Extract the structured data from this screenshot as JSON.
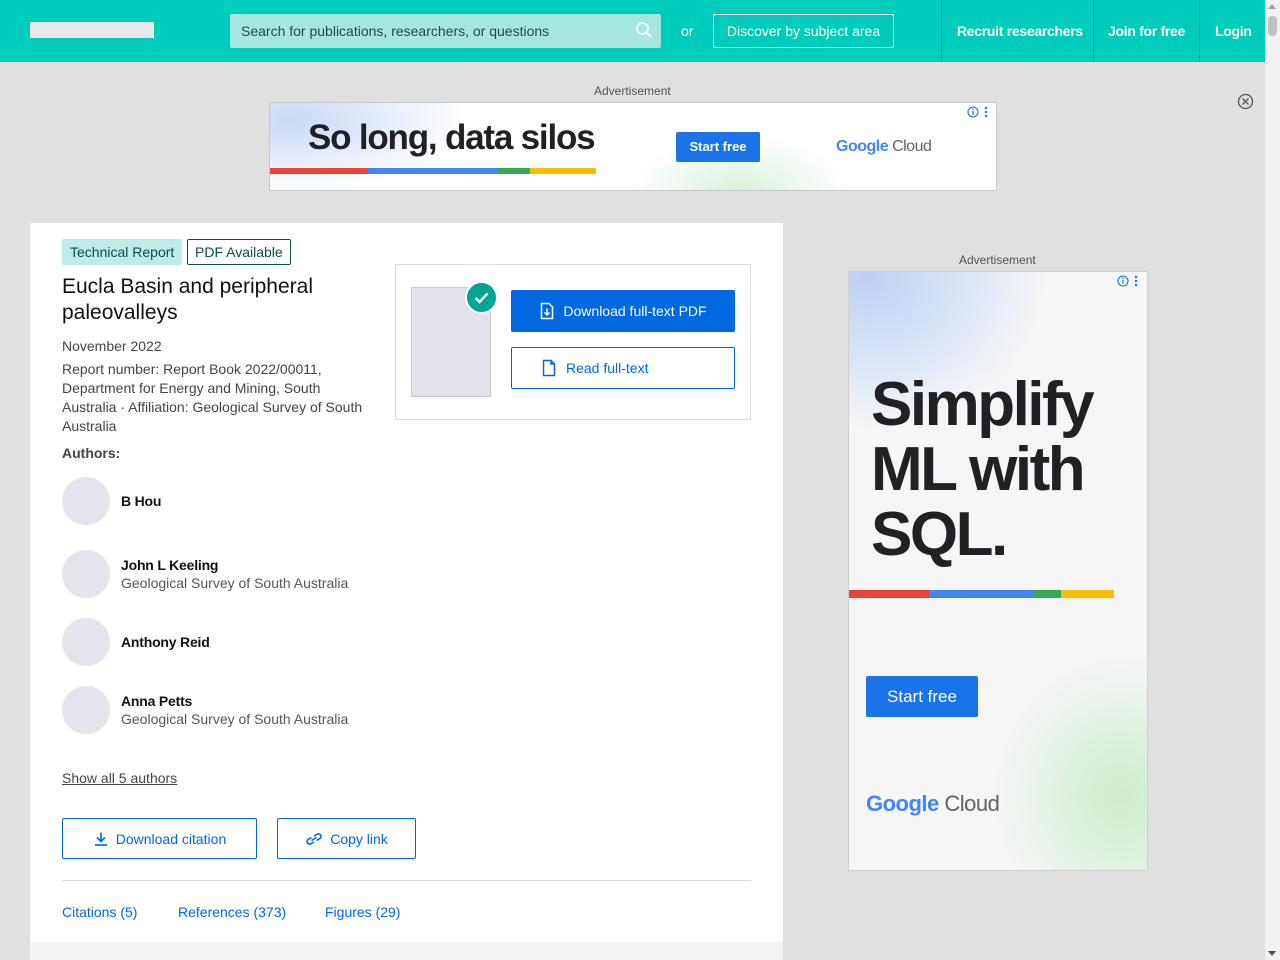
{
  "header": {
    "search_placeholder": "Search for publications, researchers, or questions",
    "or_text": "or",
    "discover_label": "Discover by subject area",
    "recruit_label": "Recruit researchers",
    "join_label": "Join for free",
    "login_label": "Login",
    "accent_color": "#00ccbb"
  },
  "ads": {
    "label": "Advertisement",
    "banner": {
      "headline": "So long, data silos",
      "button": "Start free",
      "brand": "Google",
      "brand_suffix": "Cloud"
    },
    "side": {
      "headline_lines": [
        "Simplify",
        "ML with",
        "SQL."
      ],
      "button": "Start free",
      "brand": "Google",
      "brand_suffix": "Cloud"
    }
  },
  "publication": {
    "type_badge": "Technical Report",
    "pdf_badge": "PDF Available",
    "title": "Eucla Basin and peripheral paleovalleys",
    "date": "November 2022",
    "meta": "Report number: Report Book 2022/00011, Department for Energy and Mining, South Australia · Affiliation: Geological Survey of South Australia",
    "authors_label": "Authors:",
    "authors": [
      {
        "name": "B Hou",
        "affiliation": ""
      },
      {
        "name": "John L Keeling",
        "affiliation": "Geological Survey of South Australia"
      },
      {
        "name": "Anthony Reid",
        "affiliation": ""
      },
      {
        "name": "Anna Petts",
        "affiliation": "Geological Survey of South Australia"
      }
    ],
    "show_all": "Show all 5 authors",
    "download_citation": "Download citation",
    "copy_link": "Copy link",
    "download_pdf": "Download full-text PDF",
    "read_fulltext": "Read full-text",
    "tabs": [
      "Citations (5)",
      "References (373)",
      "Figures (29)"
    ],
    "link_color": "#0068e0"
  }
}
